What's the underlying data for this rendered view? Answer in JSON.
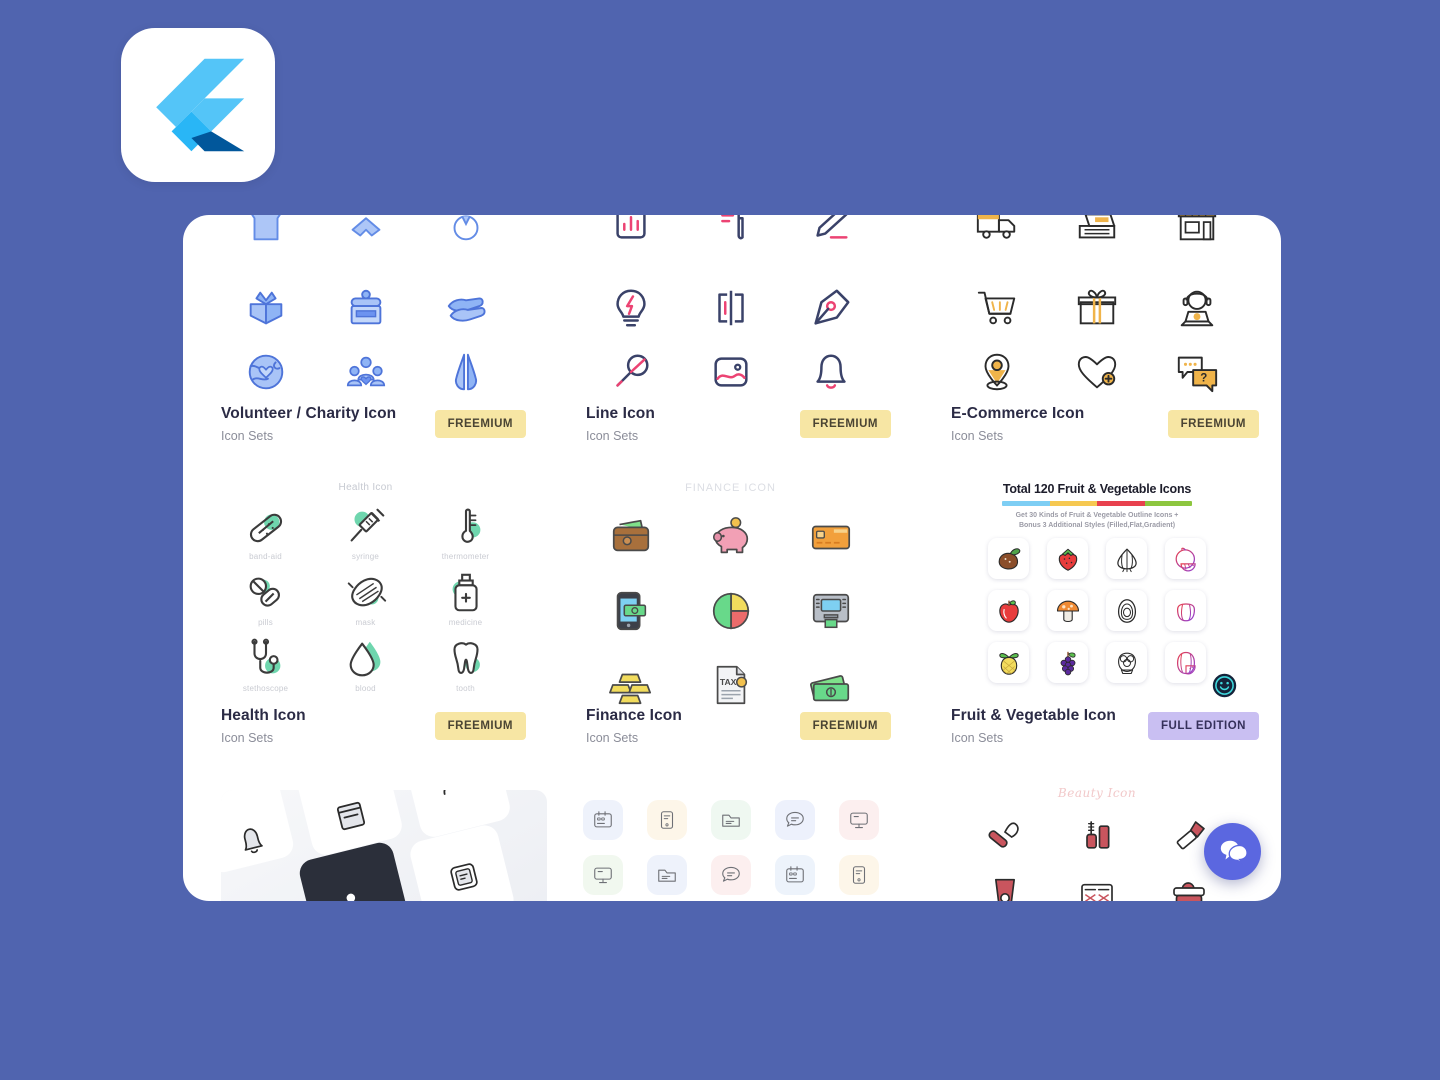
{
  "app": {
    "logo": "flutter-logo",
    "background_color": "#5064AF",
    "card_background": "#FFFFFF"
  },
  "badges": {
    "freemium": "FREEMIUM",
    "full_edition": "FULL EDITION",
    "freemium_color": "#F7E6A4",
    "full_edition_color": "#C9BFF2"
  },
  "sets": [
    {
      "title": "Volunteer / Charity Icon",
      "subtitle": "Icon Sets",
      "badge": "FREEMIUM",
      "badge_type": "freemium",
      "preview_header": "",
      "accent_color": "#6C93F0",
      "icons": [
        "donation-box-icon",
        "donation-jar-icon",
        "helping-hands-icon",
        "globe-heart-icon",
        "people-group-icon",
        "praying-hands-icon"
      ]
    },
    {
      "title": "Line Icon",
      "subtitle": "Icon Sets",
      "badge": "FREEMIUM",
      "badge_type": "freemium",
      "preview_header": "",
      "accent_color": "#3A4269",
      "icons": [
        "bar-chart-icon",
        "document-icon",
        "pencil-icon",
        "lightbulb-icon",
        "layout-icon",
        "pen-nib-icon",
        "microphone-icon",
        "image-icon",
        "bell-icon"
      ]
    },
    {
      "title": "E-Commerce Icon",
      "subtitle": "Icon Sets",
      "badge": "FREEMIUM",
      "badge_type": "freemium",
      "preview_header": "",
      "accent_color": "#F0B44A",
      "icons": [
        "delivery-truck-icon",
        "cash-register-icon",
        "storefront-icon",
        "shopping-cart-icon",
        "gift-icon",
        "customer-support-icon",
        "location-pin-icon",
        "heart-plus-icon",
        "chat-question-icon"
      ]
    },
    {
      "title": "Health Icon",
      "subtitle": "Icon Sets",
      "badge": "FREEMIUM",
      "badge_type": "freemium",
      "preview_header": "Health Icon",
      "accent_color": "#6FD6AE",
      "icon_labels": [
        "band-aid",
        "syringe",
        "thermometer",
        "pills",
        "mask",
        "medicine",
        "stethoscope",
        "blood",
        "tooth"
      ]
    },
    {
      "title": "Finance Icon",
      "subtitle": "Icon Sets",
      "badge": "FREEMIUM",
      "badge_type": "freemium",
      "preview_header": "FINANCE ICON",
      "icons": [
        "wallet-icon",
        "piggy-bank-icon",
        "credit-card-icon",
        "mobile-payment-icon",
        "pie-chart-icon",
        "atm-icon",
        "gold-bars-icon",
        "tax-document-icon",
        "cash-icon"
      ]
    },
    {
      "title": "Fruit & Vegetable Icon",
      "subtitle": "Icon Sets",
      "badge": "FULL EDITION",
      "badge_type": "full",
      "promo": {
        "headline": "Total 120 Fruit & Vegetable Icons",
        "subline_1": "Get 30 Kinds of Fruit & Vegetable Outline Icons +",
        "subline_2": "Bonus 3 Additional Styles (Filled,Flat,Gradient)",
        "bar_colors": [
          "#7ECEF4",
          "#F6C851",
          "#E8414E",
          "#8DC63F"
        ]
      },
      "icons": [
        "chestnut-icon",
        "strawberry-icon",
        "garlic-icon",
        "orange-outline-icon",
        "apple-icon",
        "mushroom-icon",
        "avocado-icon",
        "bell-pepper-outline-icon",
        "pineapple-icon",
        "grapes-icon",
        "artichoke-icon",
        "watermelon-outline-icon"
      ]
    }
  ],
  "bottom_row": {
    "tilted_set": {
      "name": "isometric-icon-card",
      "icons": [
        "bell-icon",
        "book-icon",
        "card-icon",
        "note-icon",
        "dark-tile-icon"
      ]
    },
    "mini_set": {
      "icons": [
        "calendar-icon",
        "file-icon",
        "folder-icon",
        "chat-icon",
        "monitor-icon",
        "monitor-icon",
        "folder-icon",
        "chat-icon",
        "calendar-icon",
        "file-icon"
      ],
      "tile_colors": [
        "#EEF2FB",
        "#FDF6E9",
        "#EFF8F1",
        "#EDF1FC",
        "#FCEFEF",
        "#F1F8EF",
        "#EEF2FB",
        "#FCEFEF",
        "#EDF3FB",
        "#FDF6E9"
      ]
    },
    "beauty_set": {
      "title": "Beauty Icon",
      "title_color": "#F2C9CA",
      "icons": [
        "makeup-brush-icon",
        "mascara-icon",
        "lipstick-icon",
        "cosmetic-tube-icon",
        "eyeshadow-palette-icon",
        "cream-jar-icon"
      ]
    }
  },
  "widgets": {
    "smiley_badge": "smiley-face-badge",
    "chat_fab": "chat-bubbles-icon",
    "chat_fab_color": "#5B67E0"
  }
}
